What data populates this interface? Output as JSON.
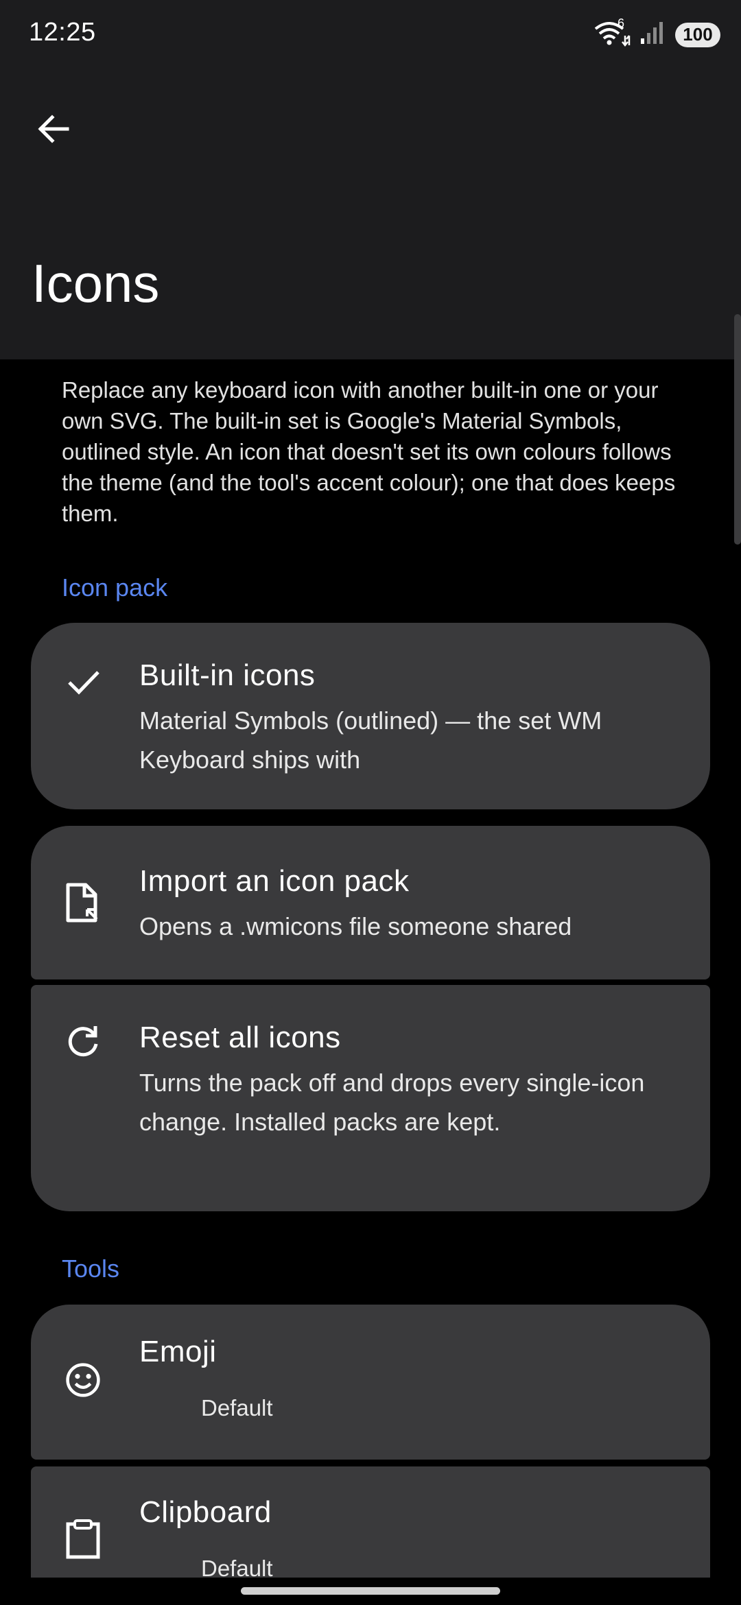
{
  "status_bar": {
    "time": "12:25",
    "wifi_label": "6",
    "battery": "100"
  },
  "header": {
    "title": "Icons"
  },
  "intro": "Replace any keyboard icon with another built-in one or your own SVG. The built-in set is Google's Material Symbols, outlined style. An icon that doesn't set its own colours follows the theme (and the tool's accent colour); one that does keeps them.",
  "icon_pack": {
    "header": "Icon pack",
    "items": [
      {
        "icon": "check-icon",
        "title": "Built-in icons",
        "subtitle": "Material Symbols (outlined) — the set WM Keyboard ships with"
      },
      {
        "icon": "file-import-icon",
        "title": "Import an icon pack",
        "subtitle": "Opens a .wmicons file someone shared"
      },
      {
        "icon": "refresh-icon",
        "title": "Reset all icons",
        "subtitle": "Turns the pack off and drops every single-icon change. Installed packs are kept."
      }
    ]
  },
  "tools": {
    "header": "Tools",
    "items": [
      {
        "icon": "smiley-icon",
        "title": "Emoji",
        "value": "Default"
      },
      {
        "icon": "clipboard-icon",
        "title": "Clipboard",
        "value": "Default"
      }
    ]
  },
  "colors": {
    "accent": "#5a86f0",
    "card": "#3a3a3c",
    "appbar": "#1c1c1e",
    "background": "#000000"
  }
}
